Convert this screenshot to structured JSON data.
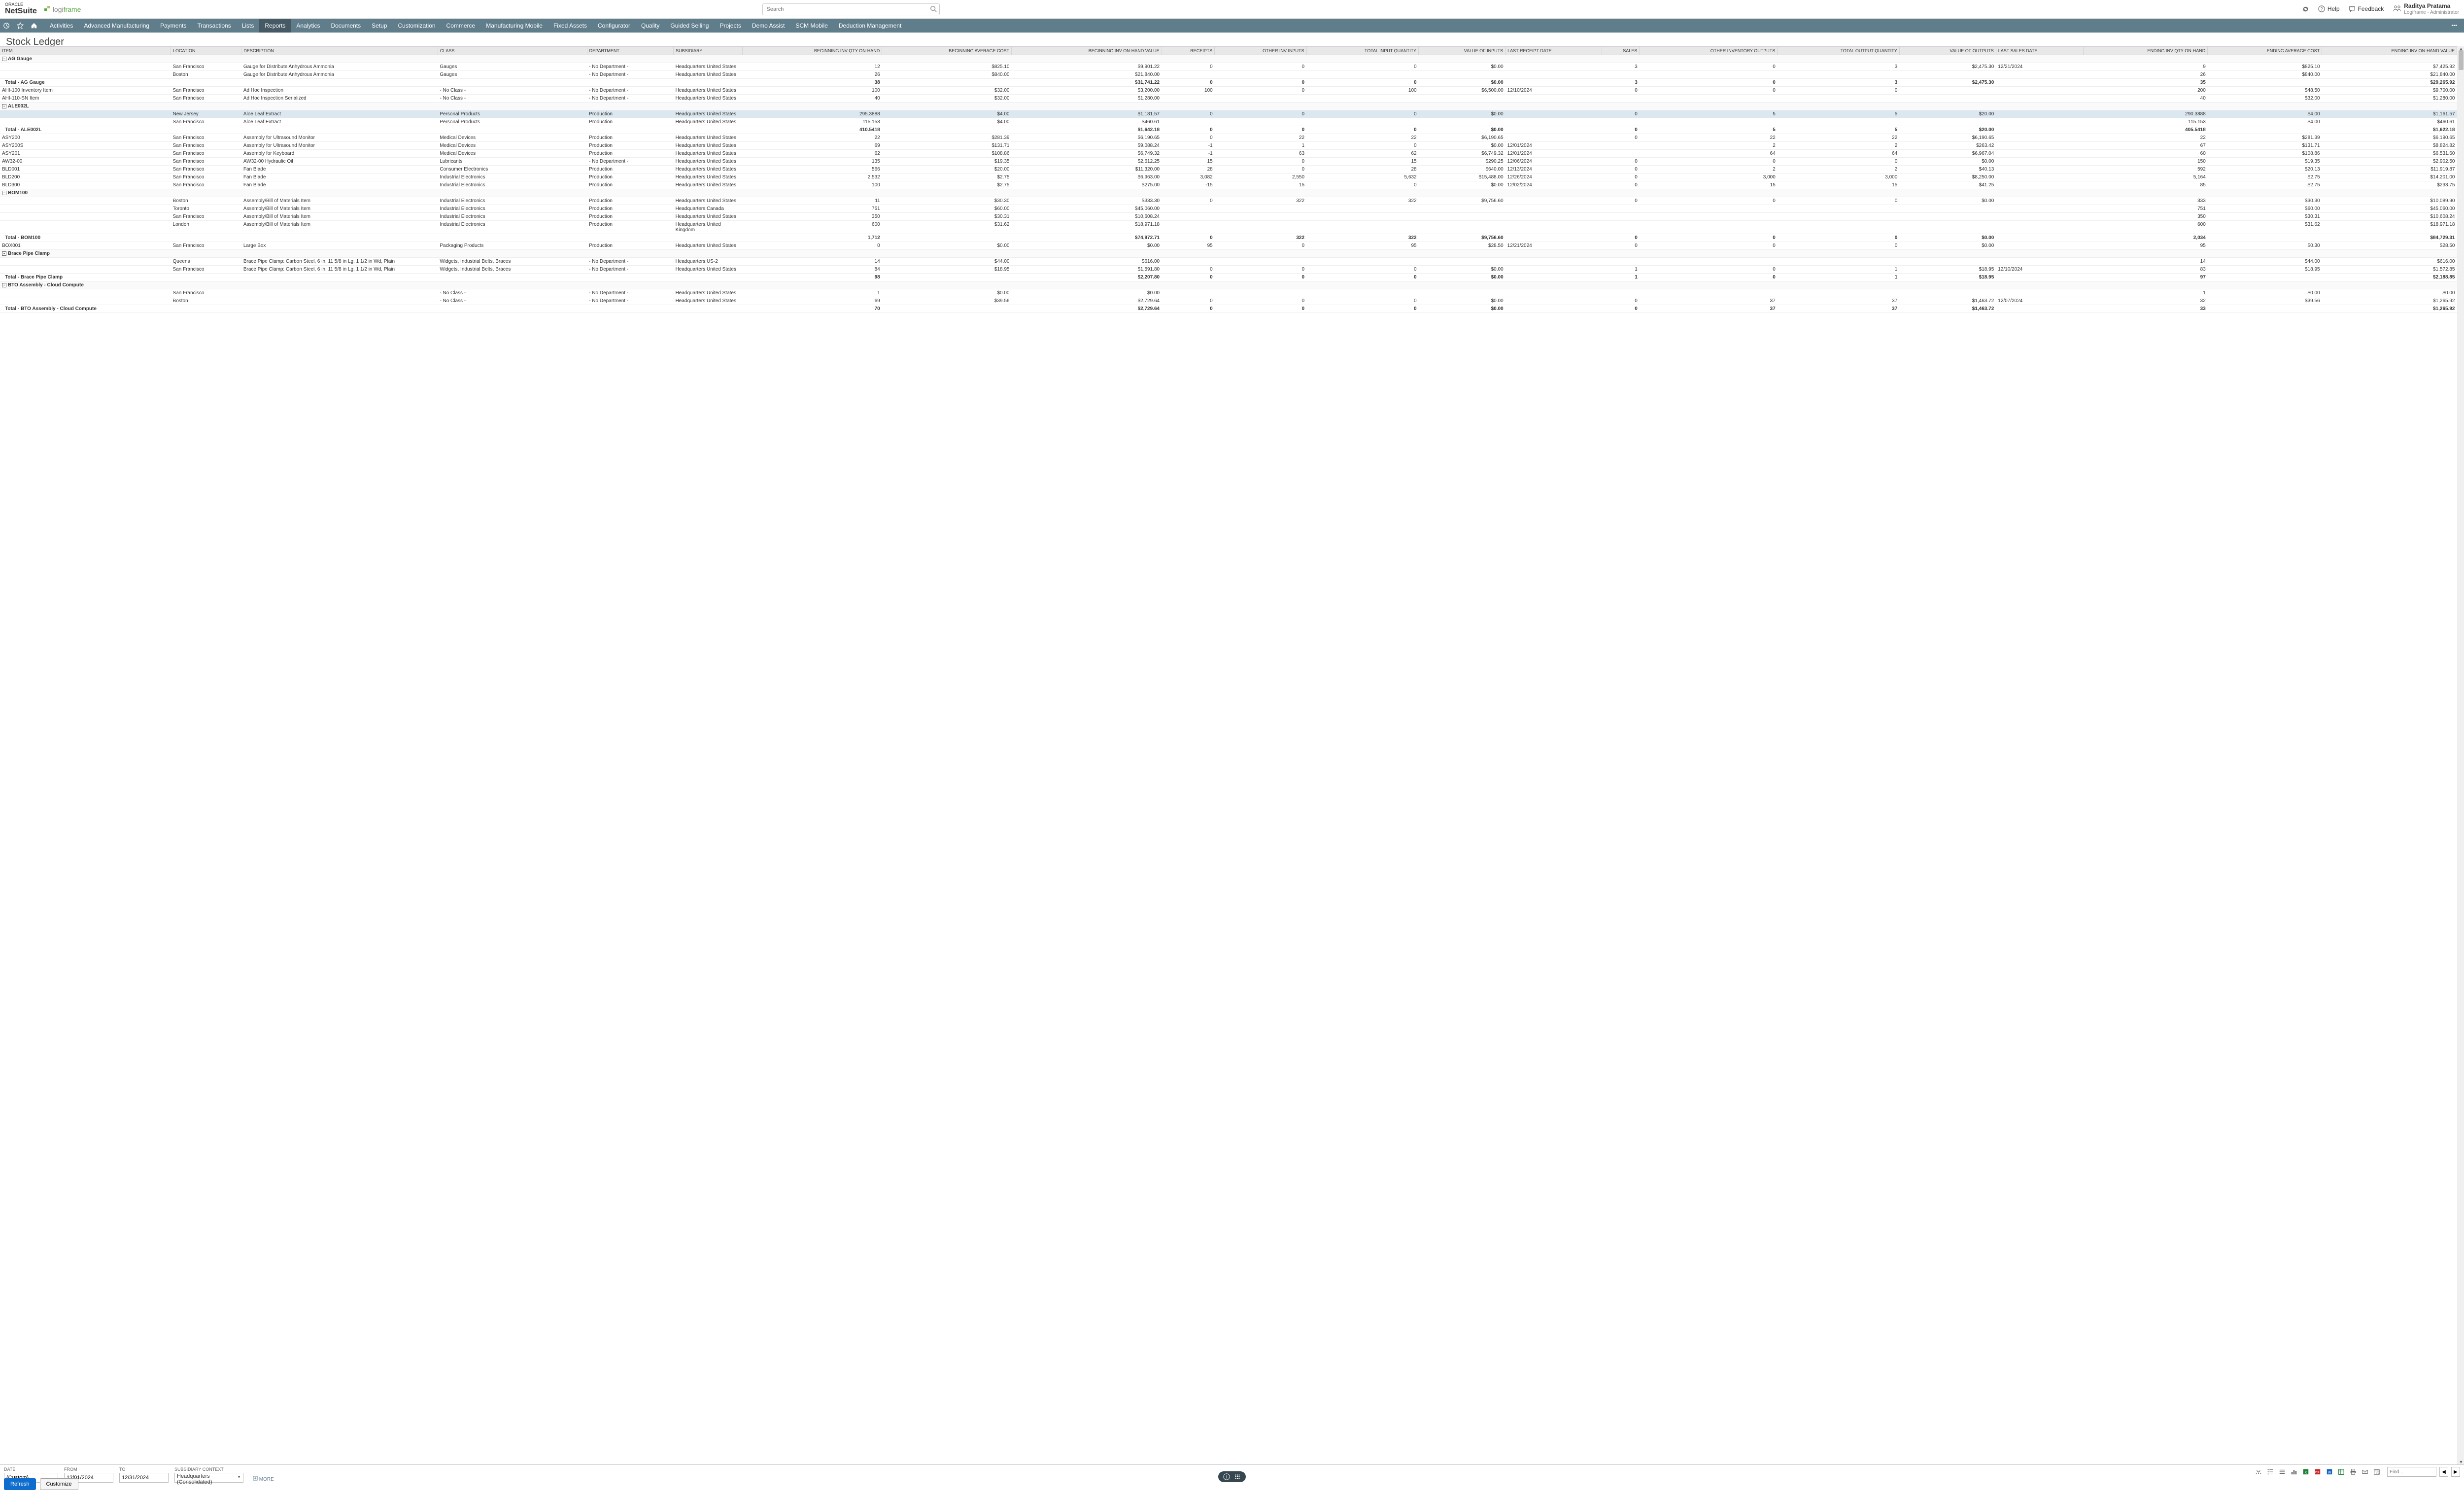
{
  "header": {
    "oracle": "ORACLE",
    "netsuite": "NetSuite",
    "partner_a": "logi",
    "partner_b": "frame",
    "search_placeholder": "Search",
    "help": "Help",
    "feedback": "Feedback",
    "user_name": "Raditya Pratama",
    "user_role": "Logiframe - Administrator"
  },
  "nav": [
    "Activities",
    "Advanced Manufacturing",
    "Payments",
    "Transactions",
    "Lists",
    "Reports",
    "Analytics",
    "Documents",
    "Setup",
    "Customization",
    "Commerce",
    "Manufacturing Mobile",
    "Fixed Assets",
    "Configurator",
    "Quality",
    "Guided Selling",
    "Projects",
    "Demo Assist",
    "SCM Mobile",
    "Deduction Management"
  ],
  "nav_active": 5,
  "page_title": "Stock Ledger",
  "columns": [
    "ITEM",
    "LOCATION",
    "DESCRIPTION",
    "CLASS",
    "DEPARTMENT",
    "SUBSIDIARY",
    "BEGINNING INV QTY ON-HAND",
    "BEGINNING AVERAGE COST",
    "BEGINNING INV ON-HAND VALUE",
    "RECEIPTS",
    "OTHER INV INPUTS",
    "TOTAL INPUT QUANTITY",
    "VALUE OF INPUTS",
    "LAST RECEIPT DATE",
    "SALES",
    "OTHER INVENTORY OUTPUTS",
    "TOTAL OUTPUT QUANTITY",
    "VALUE OF OUTPUTS",
    "LAST SALES DATE",
    "ENDING INV QTY ON-HAND",
    "ENDING AVERAGE COST",
    "ENDING INV ON-HAND VALUE"
  ],
  "col_numeric": [
    false,
    false,
    false,
    false,
    false,
    false,
    true,
    true,
    true,
    true,
    true,
    true,
    true,
    false,
    true,
    true,
    true,
    true,
    false,
    true,
    true,
    true
  ],
  "rows": [
    {
      "t": "group",
      "exp": "-",
      "c": [
        "AG Gauge",
        "",
        "",
        "",
        "",
        "",
        "",
        "",
        "",
        "",
        "",
        "",
        "",
        "",
        "",
        "",
        "",
        "",
        "",
        "",
        "",
        ""
      ]
    },
    {
      "t": "row",
      "c": [
        "",
        "San Francisco",
        "Gauge for Distribute Anhydrous Ammonia",
        "Gauges",
        "- No Department -",
        "Headquarters:United States",
        "12",
        "$825.10",
        "$9,901.22",
        "0",
        "0",
        "0",
        "$0.00",
        "",
        "3",
        "0",
        "3",
        "$2,475.30",
        "12/21/2024",
        "9",
        "$825.10",
        "$7,425.92"
      ]
    },
    {
      "t": "row",
      "c": [
        "",
        "Boston",
        "Gauge for Distribute Anhydrous Ammonia",
        "Gauges",
        "- No Department -",
        "Headquarters:United States",
        "26",
        "$840.00",
        "$21,840.00",
        "",
        "",
        "",
        "",
        "",
        "",
        "",
        "",
        "",
        "",
        "26",
        "$840.00",
        "$21,840.00"
      ]
    },
    {
      "t": "total",
      "c": [
        "Total - AG Gauge",
        "",
        "",
        "",
        "",
        "",
        "38",
        "",
        "$31,741.22",
        "0",
        "0",
        "0",
        "$0.00",
        "",
        "3",
        "0",
        "3",
        "$2,475.30",
        "",
        "35",
        "",
        "$29,265.92"
      ]
    },
    {
      "t": "row",
      "c": [
        "AHI-100 Inventory Item",
        "San Francisco",
        "Ad Hoc Inspection",
        "- No Class -",
        "- No Department -",
        "Headquarters:United States",
        "100",
        "$32.00",
        "$3,200.00",
        "100",
        "0",
        "100",
        "$6,500.00",
        "12/10/2024",
        "0",
        "0",
        "0",
        "",
        "",
        "200",
        "$48.50",
        "$9,700.00"
      ]
    },
    {
      "t": "row",
      "c": [
        "AHI-110-SN Item",
        "San Francisco",
        "Ad Hoc Inspection Serialized",
        "- No Class -",
        "- No Department -",
        "Headquarters:United States",
        "40",
        "$32.00",
        "$1,280.00",
        "",
        "",
        "",
        "",
        "",
        "",
        "",
        "",
        "",
        "",
        "40",
        "$32.00",
        "$1,280.00"
      ]
    },
    {
      "t": "group",
      "exp": "-",
      "c": [
        "ALE002L",
        "",
        "",
        "",
        "",
        "",
        "",
        "",
        "",
        "",
        "",
        "",
        "",
        "",
        "",
        "",
        "",
        "",
        "",
        "",
        "",
        ""
      ]
    },
    {
      "t": "row",
      "hl": true,
      "c": [
        "",
        "New Jersey",
        "Aloe Leaf Extract",
        "Personal Products",
        "Production",
        "Headquarters:United States",
        "295.3888",
        "$4.00",
        "$1,181.57",
        "0",
        "0",
        "0",
        "$0.00",
        "",
        "0",
        "5",
        "5",
        "$20.00",
        "",
        "290.3888",
        "$4.00",
        "$1,161.57"
      ]
    },
    {
      "t": "row",
      "c": [
        "",
        "San Francisco",
        "Aloe Leaf Extract",
        "Personal Products",
        "Production",
        "Headquarters:United States",
        "115.153",
        "$4.00",
        "$460.61",
        "",
        "",
        "",
        "",
        "",
        "",
        "",
        "",
        "",
        "",
        "115.153",
        "$4.00",
        "$460.61"
      ]
    },
    {
      "t": "total",
      "c": [
        "Total - ALE002L",
        "",
        "",
        "",
        "",
        "",
        "410.5418",
        "",
        "$1,642.18",
        "0",
        "0",
        "0",
        "$0.00",
        "",
        "0",
        "5",
        "5",
        "$20.00",
        "",
        "405.5418",
        "",
        "$1,622.18"
      ]
    },
    {
      "t": "row",
      "c": [
        "ASY200",
        "San Francisco",
        "Assembly for Ultrasound Monitor",
        "Medical Devices",
        "Production",
        "Headquarters:United States",
        "22",
        "$281.39",
        "$6,190.65",
        "0",
        "22",
        "22",
        "$6,190.65",
        "",
        "0",
        "22",
        "22",
        "$6,190.65",
        "",
        "22",
        "$281.39",
        "$6,190.65"
      ]
    },
    {
      "t": "row",
      "c": [
        "ASY200S",
        "San Francisco",
        "Assembly for Ultrasound Monitor",
        "Medical Devices",
        "Production",
        "Headquarters:United States",
        "69",
        "$131.71",
        "$9,088.24",
        "-1",
        "1",
        "0",
        "$0.00",
        "12/01/2024",
        "",
        "2",
        "2",
        "$263.42",
        "",
        "67",
        "$131.71",
        "$8,824.82"
      ]
    },
    {
      "t": "row",
      "c": [
        "ASY201",
        "San Francisco",
        "Assembly for Keyboard",
        "Medical Devices",
        "Production",
        "Headquarters:United States",
        "62",
        "$108.86",
        "$6,749.32",
        "-1",
        "63",
        "62",
        "$6,749.32",
        "12/01/2024",
        "",
        "64",
        "64",
        "$6,967.04",
        "",
        "60",
        "$108.86",
        "$6,531.60"
      ]
    },
    {
      "t": "row",
      "c": [
        "AW32-00",
        "San Francisco",
        "AW32-00 Hydraulic Oil",
        "Lubricants",
        "- No Department -",
        "Headquarters:United States",
        "135",
        "$19.35",
        "$2,612.25",
        "15",
        "0",
        "15",
        "$290.25",
        "12/06/2024",
        "0",
        "0",
        "0",
        "$0.00",
        "",
        "150",
        "$19.35",
        "$2,902.50"
      ]
    },
    {
      "t": "row",
      "c": [
        "BLD001",
        "San Francisco",
        "Fan Blade",
        "Consumer Electronics",
        "Production",
        "Headquarters:United States",
        "566",
        "$20.00",
        "$11,320.00",
        "28",
        "0",
        "28",
        "$640.00",
        "12/13/2024",
        "0",
        "2",
        "2",
        "$40.13",
        "",
        "592",
        "$20.13",
        "$11,919.87"
      ]
    },
    {
      "t": "row",
      "c": [
        "BLD200",
        "San Francisco",
        "Fan Blade",
        "Industrial Electronics",
        "Production",
        "Headquarters:United States",
        "2,532",
        "$2.75",
        "$6,963.00",
        "3,082",
        "2,550",
        "5,632",
        "$15,488.00",
        "12/26/2024",
        "0",
        "3,000",
        "3,000",
        "$8,250.00",
        "",
        "5,164",
        "$2.75",
        "$14,201.00"
      ]
    },
    {
      "t": "row",
      "c": [
        "BLD300",
        "San Francisco",
        "Fan Blade",
        "Industrial Electronics",
        "Production",
        "Headquarters:United States",
        "100",
        "$2.75",
        "$275.00",
        "-15",
        "15",
        "0",
        "$0.00",
        "12/02/2024",
        "0",
        "15",
        "15",
        "$41.25",
        "",
        "85",
        "$2.75",
        "$233.75"
      ]
    },
    {
      "t": "group",
      "exp": "-",
      "c": [
        "BOM100",
        "",
        "",
        "",
        "",
        "",
        "",
        "",
        "",
        "",
        "",
        "",
        "",
        "",
        "",
        "",
        "",
        "",
        "",
        "",
        "",
        ""
      ]
    },
    {
      "t": "row",
      "c": [
        "",
        "Boston",
        "Assembly/Bill of Materials Item",
        "Industrial Electronics",
        "Production",
        "Headquarters:United States",
        "11",
        "$30.30",
        "$333.30",
        "0",
        "322",
        "322",
        "$9,756.60",
        "",
        "0",
        "0",
        "0",
        "$0.00",
        "",
        "333",
        "$30.30",
        "$10,089.90"
      ]
    },
    {
      "t": "row",
      "c": [
        "",
        "Toronto",
        "Assembly/Bill of Materials Item",
        "Industrial Electronics",
        "Production",
        "Headquarters:Canada",
        "751",
        "$60.00",
        "$45,060.00",
        "",
        "",
        "",
        "",
        "",
        "",
        "",
        "",
        "",
        "",
        "751",
        "$60.00",
        "$45,060.00"
      ]
    },
    {
      "t": "row",
      "c": [
        "",
        "San Francisco",
        "Assembly/Bill of Materials Item",
        "Industrial Electronics",
        "Production",
        "Headquarters:United States",
        "350",
        "$30.31",
        "$10,608.24",
        "",
        "",
        "",
        "",
        "",
        "",
        "",
        "",
        "",
        "",
        "350",
        "$30.31",
        "$10,608.24"
      ]
    },
    {
      "t": "row",
      "c": [
        "",
        "London",
        "Assembly/Bill of Materials Item",
        "Industrial Electronics",
        "Production",
        "Headquarters:United Kingdom",
        "600",
        "$31.62",
        "$18,971.18",
        "",
        "",
        "",
        "",
        "",
        "",
        "",
        "",
        "",
        "",
        "600",
        "$31.62",
        "$18,971.18"
      ]
    },
    {
      "t": "total",
      "c": [
        "Total - BOM100",
        "",
        "",
        "",
        "",
        "",
        "1,712",
        "",
        "$74,972.71",
        "0",
        "322",
        "322",
        "$9,756.60",
        "",
        "0",
        "0",
        "0",
        "$0.00",
        "",
        "2,034",
        "",
        "$84,729.31"
      ]
    },
    {
      "t": "row",
      "c": [
        "BOX001",
        "San Francisco",
        "Large Box",
        "Packaging Products",
        "Production",
        "Headquarters:United States",
        "0",
        "$0.00",
        "$0.00",
        "95",
        "0",
        "95",
        "$28.50",
        "12/21/2024",
        "0",
        "0",
        "0",
        "$0.00",
        "",
        "95",
        "$0.30",
        "$28.50"
      ]
    },
    {
      "t": "group",
      "exp": "-",
      "c": [
        "Brace Pipe Clamp",
        "",
        "",
        "",
        "",
        "",
        "",
        "",
        "",
        "",
        "",
        "",
        "",
        "",
        "",
        "",
        "",
        "",
        "",
        "",
        "",
        ""
      ]
    },
    {
      "t": "row",
      "c": [
        "",
        "Queens",
        "Brace Pipe Clamp: Carbon Steel, 6 in, 11 5/8 in Lg, 1 1/2 in Wd, Plain",
        "Widgets, Industrial Belts, Braces",
        "- No Department -",
        "Headquarters:US-2",
        "14",
        "$44.00",
        "$616.00",
        "",
        "",
        "",
        "",
        "",
        "",
        "",
        "",
        "",
        "",
        "14",
        "$44.00",
        "$616.00"
      ]
    },
    {
      "t": "row",
      "c": [
        "",
        "San Francisco",
        "Brace Pipe Clamp: Carbon Steel, 6 in, 11 5/8 in Lg, 1 1/2 in Wd, Plain",
        "Widgets, Industrial Belts, Braces",
        "- No Department -",
        "Headquarters:United States",
        "84",
        "$18.95",
        "$1,591.80",
        "0",
        "0",
        "0",
        "$0.00",
        "",
        "1",
        "0",
        "1",
        "$18.95",
        "12/10/2024",
        "83",
        "$18.95",
        "$1,572.85"
      ]
    },
    {
      "t": "total",
      "c": [
        "Total - Brace Pipe Clamp",
        "",
        "",
        "",
        "",
        "",
        "98",
        "",
        "$2,207.80",
        "0",
        "0",
        "0",
        "$0.00",
        "",
        "1",
        "0",
        "1",
        "$18.95",
        "",
        "97",
        "",
        "$2,188.85"
      ]
    },
    {
      "t": "group",
      "exp": "-",
      "c": [
        "BTO Assembly - Cloud Compute",
        "",
        "",
        "",
        "",
        "",
        "",
        "",
        "",
        "",
        "",
        "",
        "",
        "",
        "",
        "",
        "",
        "",
        "",
        "",
        "",
        ""
      ]
    },
    {
      "t": "row",
      "c": [
        "",
        "San Francisco",
        "",
        "- No Class -",
        "- No Department -",
        "Headquarters:United States",
        "1",
        "$0.00",
        "$0.00",
        "",
        "",
        "",
        "",
        "",
        "",
        "",
        "",
        "",
        "",
        "1",
        "$0.00",
        "$0.00"
      ]
    },
    {
      "t": "row",
      "c": [
        "",
        "Boston",
        "",
        "- No Class -",
        "- No Department -",
        "Headquarters:United States",
        "69",
        "$39.56",
        "$2,729.64",
        "0",
        "0",
        "0",
        "$0.00",
        "",
        "0",
        "37",
        "37",
        "$1,463.72",
        "12/07/2024",
        "32",
        "$39.56",
        "$1,265.92"
      ]
    },
    {
      "t": "total",
      "c": [
        "Total - BTO Assembly - Cloud Compute",
        "",
        "",
        "",
        "",
        "",
        "70",
        "",
        "$2,729.64",
        "0",
        "0",
        "0",
        "$0.00",
        "",
        "0",
        "37",
        "37",
        "$1,463.72",
        "",
        "33",
        "",
        "$1,265.92"
      ]
    }
  ],
  "footer": {
    "date_label": "DATE",
    "date_value": "(Custom)",
    "from_label": "FROM",
    "from_value": "12/01/2024",
    "to_label": "TO",
    "to_value": "12/31/2024",
    "sub_label": "SUBSIDIARY CONTEXT",
    "sub_value": "Headquarters (Consolidated)",
    "more": "MORE",
    "refresh": "Refresh",
    "customize": "Customize",
    "find_placeholder": "Find..."
  }
}
